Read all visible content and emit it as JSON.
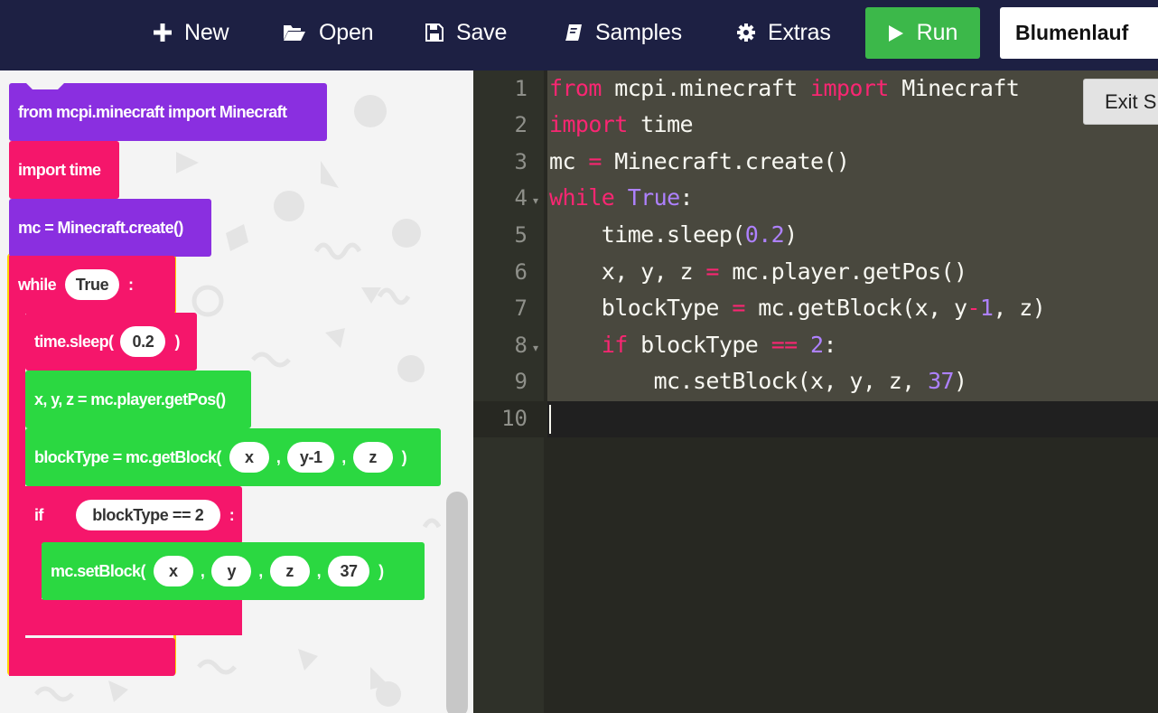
{
  "toolbar": {
    "new_label": "New",
    "open_label": "Open",
    "save_label": "Save",
    "samples_label": "Samples",
    "extras_label": "Extras",
    "run_label": "Run",
    "program_name": "Blumenlauf",
    "run_color": "#3cb84a"
  },
  "blocks": {
    "import_minecraft": "from mcpi.minecraft import Minecraft",
    "import_time": "import time",
    "create": "mc = Minecraft.create()",
    "while_label": "while",
    "while_cond": "True",
    "while_colon": ":",
    "sleep_label": "time.sleep(",
    "sleep_value": "0.2",
    "sleep_close": ")",
    "getpos": "x, y, z = mc.player.getPos()",
    "getblock_label": "blockType = mc.getBlock(",
    "getblock_args": [
      "x",
      "y-1",
      "z"
    ],
    "getblock_close": ")",
    "if_label": "if",
    "if_cond": "blockType == 2",
    "if_colon": ":",
    "setblock_label": "mc.setBlock(",
    "setblock_args": [
      "x",
      "y",
      "z",
      "37"
    ],
    "setblock_close": ")",
    "comma": ",",
    "colors": {
      "purple": "#8a2fe0",
      "pink": "#f5166b",
      "green": "#2bd841",
      "loop_outline": "#ffd400"
    }
  },
  "editor": {
    "line_numbers": [
      "1",
      "2",
      "3",
      "4",
      "5",
      "6",
      "7",
      "8",
      "9",
      "10"
    ],
    "exit_label": "Exit S",
    "theme": "monokai"
  }
}
